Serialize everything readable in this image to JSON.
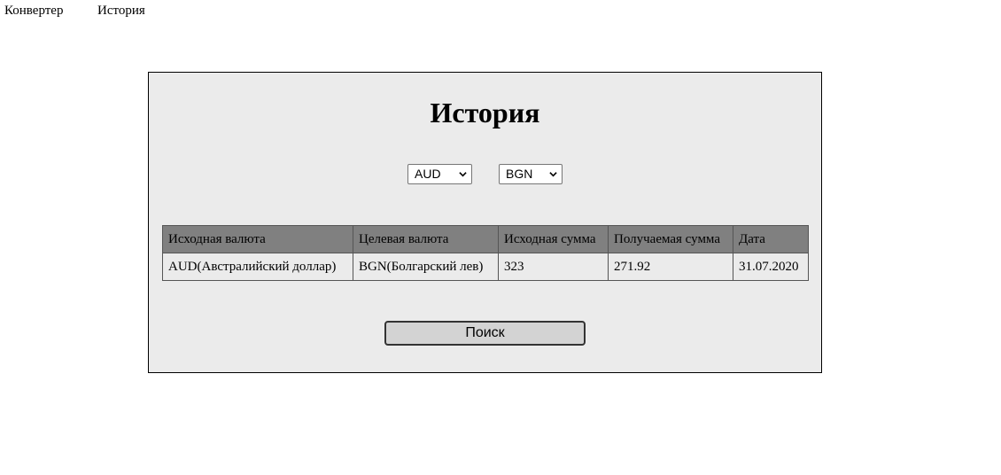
{
  "nav": {
    "converter_label": "Конвертер",
    "history_label": "История"
  },
  "main": {
    "title": "История",
    "from_currency": "AUD",
    "to_currency": "BGN",
    "table": {
      "headers": [
        "Исходная валюта",
        "Целевая валюта",
        "Исходная сумма",
        "Получаемая сумма",
        "Дата"
      ],
      "rows": [
        [
          "AUD(Австралийский доллар)",
          "BGN(Болгарский лев)",
          "323",
          "271.92",
          "31.07.2020"
        ]
      ]
    },
    "search_label": "Поиск"
  }
}
